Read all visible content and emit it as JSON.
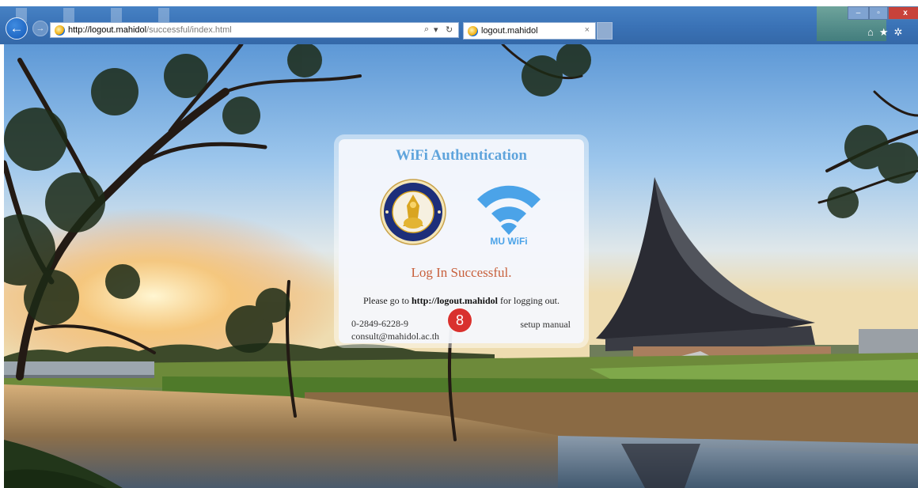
{
  "browser": {
    "url_host": "http://logout.mahidol",
    "url_path": "/successful/index.html",
    "search_glyph": "⌕",
    "dropdown_glyph": "▾",
    "refresh_glyph": "↻",
    "tab_title": "logout.mahidol",
    "tab_close": "×",
    "back_glyph": "←",
    "forward_glyph": "→",
    "min_glyph": "–",
    "max_glyph": "▫",
    "close_glyph": "x",
    "tool_icons": "⌂★✲",
    "icons": [
      "back-arrow-icon",
      "forward-arrow-icon",
      "ie-favicon",
      "search-icon",
      "refresh-icon",
      "home-icon",
      "favorites-star-icon",
      "settings-gear-icon"
    ]
  },
  "card": {
    "title": "WiFi Authentication",
    "wifi_label": "MU WiFi",
    "status": "Log In Successful.",
    "instruction_prefix": "Please go to ",
    "instruction_link": "http://logout.mahidol",
    "instruction_suffix": " for logging out.",
    "phone": "0-2849-6228-9",
    "email": "consult@mahidol.ac.th",
    "manual": "setup manual",
    "badge": "8"
  },
  "colors": {
    "title": "#5fa4dc",
    "status": "#c8603c",
    "wifi": "#4ba3e8",
    "badge": "#d9312e",
    "seal_navy": "#1d2f7a",
    "seal_gold": "#d9a520"
  }
}
